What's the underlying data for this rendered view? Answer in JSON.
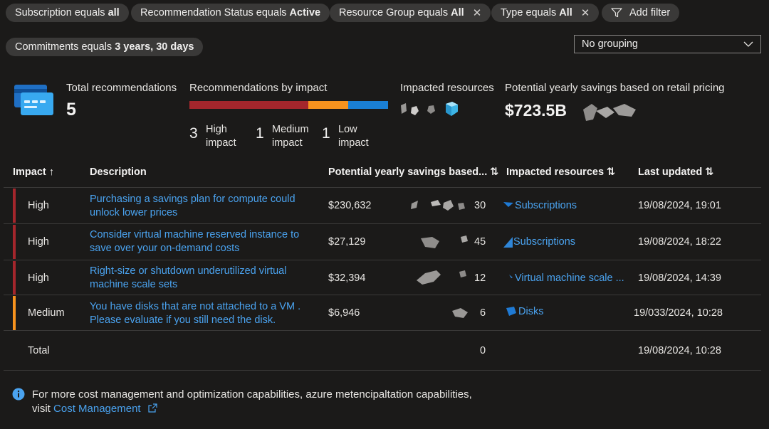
{
  "filters": [
    {
      "prefix": "Subscription equals",
      "value": "all",
      "removable": false
    },
    {
      "prefix": "Recommendation Status equals",
      "value": "Active",
      "removable": false
    },
    {
      "prefix": "Resource Group equals",
      "value": "All",
      "removable": true
    },
    {
      "prefix": "Type equals",
      "value": "All",
      "removable": true
    }
  ],
  "commitments_filter": {
    "prefix": "Commitments equals",
    "value": "3 years, 30 days"
  },
  "add_filter_label": "Add filter",
  "grouping": {
    "selected": "No grouping"
  },
  "summary": {
    "total_label": "Total recommendations",
    "total_value": "5",
    "by_impact_label": "Recommendations by impact",
    "impact_bar": {
      "high": 3,
      "medium": 1,
      "low": 1,
      "colors": {
        "high": "#a4262c",
        "medium": "#f7931e",
        "low": "#1a7fd4"
      }
    },
    "high": {
      "count": "3",
      "line1": "High",
      "line2": "impact"
    },
    "medium": {
      "count": "1",
      "line1": "Medium",
      "line2": "impact"
    },
    "low": {
      "count": "1",
      "line1": "Low",
      "line2": "impact"
    },
    "impacted_label": "Impacted resources",
    "savings_label": "Potential yearly savings based on retail pricing",
    "savings_value": "$723.5B"
  },
  "table": {
    "headers": {
      "impact": "Impact ↑",
      "description": "Description",
      "savings": "Potential yearly savings based... ⇅",
      "resources": "Impacted resources ⇅",
      "updated": "Last updated ⇅"
    },
    "rows": [
      {
        "impact": "High",
        "impact_color": "#a4262c",
        "line1": "Purchasing a savings plan for compute could",
        "line2": "unlock lower prices",
        "savings": "$230,632",
        "count": "30",
        "resource": "Subscriptions",
        "updated": "19/08/2024, 19:01"
      },
      {
        "impact": "High",
        "impact_color": "#a4262c",
        "line1": "Consider virtual machine reserved instance to",
        "line2": "save over your on-demand costs",
        "savings": "$27,129",
        "count": "45",
        "resource": "Subscriptions",
        "updated": "19/08/2024, 18:22"
      },
      {
        "impact": "High",
        "impact_color": "#a4262c",
        "line1": "Right-size or shutdown underutilized virtual",
        "line2": "machine scale sets",
        "savings": "$32,394",
        "count": "12",
        "resource": "Virtual machine scale ...",
        "updated": "19/08/2024, 14:39"
      },
      {
        "impact": "Medium",
        "impact_color": "#f7931e",
        "line1": "You have disks that are not attached to a VM .",
        "line2": "Please evaluate if you still need the disk.",
        "savings": "$6,946",
        "count": "6",
        "resource": "Disks",
        "updated": "19/033/2024, 10:28"
      }
    ],
    "total": {
      "label": "Total",
      "count": "0",
      "updated": "19/08/2024, 10:28"
    }
  },
  "footer": {
    "line1": "For more cost management and optimization capabilities, azure metencipaltation capabilities,",
    "line2_prefix": "visit",
    "link": "Cost Management"
  }
}
